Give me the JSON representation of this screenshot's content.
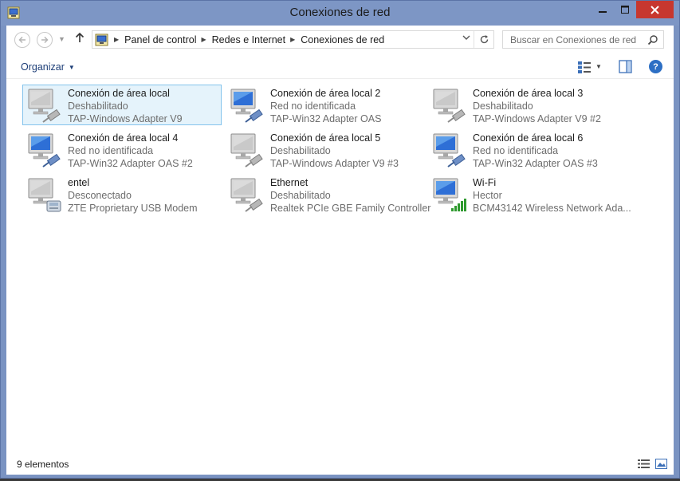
{
  "window": {
    "title": "Conexiones de red"
  },
  "address": {
    "crumbs": [
      "Panel de control",
      "Redes e Internet",
      "Conexiones de red"
    ]
  },
  "search": {
    "placeholder": "Buscar en Conexiones de red"
  },
  "toolbar": {
    "organize_label": "Organizar"
  },
  "connections": [
    {
      "name": "Conexión de área local",
      "status": "Deshabilitado",
      "device": "TAP-Windows Adapter V9",
      "type": "ethernet",
      "state": "disabled",
      "selected": true
    },
    {
      "name": "Conexión de área local 2",
      "status": "Red no identificada",
      "device": "TAP-Win32 Adapter OAS",
      "type": "ethernet",
      "state": "enabled",
      "selected": false
    },
    {
      "name": "Conexión de área local 3",
      "status": "Deshabilitado",
      "device": "TAP-Windows Adapter V9 #2",
      "type": "ethernet",
      "state": "disabled",
      "selected": false
    },
    {
      "name": "Conexión de área local 4",
      "status": "Red no identificada",
      "device": "TAP-Win32 Adapter OAS #2",
      "type": "ethernet",
      "state": "enabled",
      "selected": false
    },
    {
      "name": "Conexión de área local 5",
      "status": "Deshabilitado",
      "device": "TAP-Windows Adapter V9 #3",
      "type": "ethernet",
      "state": "disabled",
      "selected": false
    },
    {
      "name": "Conexión de área local 6",
      "status": "Red no identificada",
      "device": "TAP-Win32 Adapter OAS #3",
      "type": "ethernet",
      "state": "enabled",
      "selected": false
    },
    {
      "name": "entel",
      "status": "Desconectado",
      "device": "ZTE Proprietary USB Modem",
      "type": "modem",
      "state": "disabled",
      "selected": false
    },
    {
      "name": "Ethernet",
      "status": "Deshabilitado",
      "device": "Realtek PCIe GBE Family Controller",
      "type": "ethernet",
      "state": "disabled",
      "selected": false
    },
    {
      "name": "Wi-Fi",
      "status": "Hector",
      "device": "BCM43142 Wireless Network Ada...",
      "type": "wifi",
      "state": "enabled",
      "selected": false
    }
  ],
  "statusbar": {
    "item_count": "9 elementos"
  },
  "colors": {
    "titlebar": "#7d96c5",
    "close_button": "#c7372f",
    "selection_bg": "#e5f3fb",
    "selection_border": "#84c3ec",
    "link_text": "#1e3f78",
    "secondary_text": "#6d6d6d"
  },
  "icons": {
    "app": "network-connections-icon",
    "search": "magnifier-icon",
    "help": "help-icon",
    "ethernet": "network-adapter-icon",
    "modem": "modem-icon",
    "wifi": "wifi-signal-icon"
  }
}
